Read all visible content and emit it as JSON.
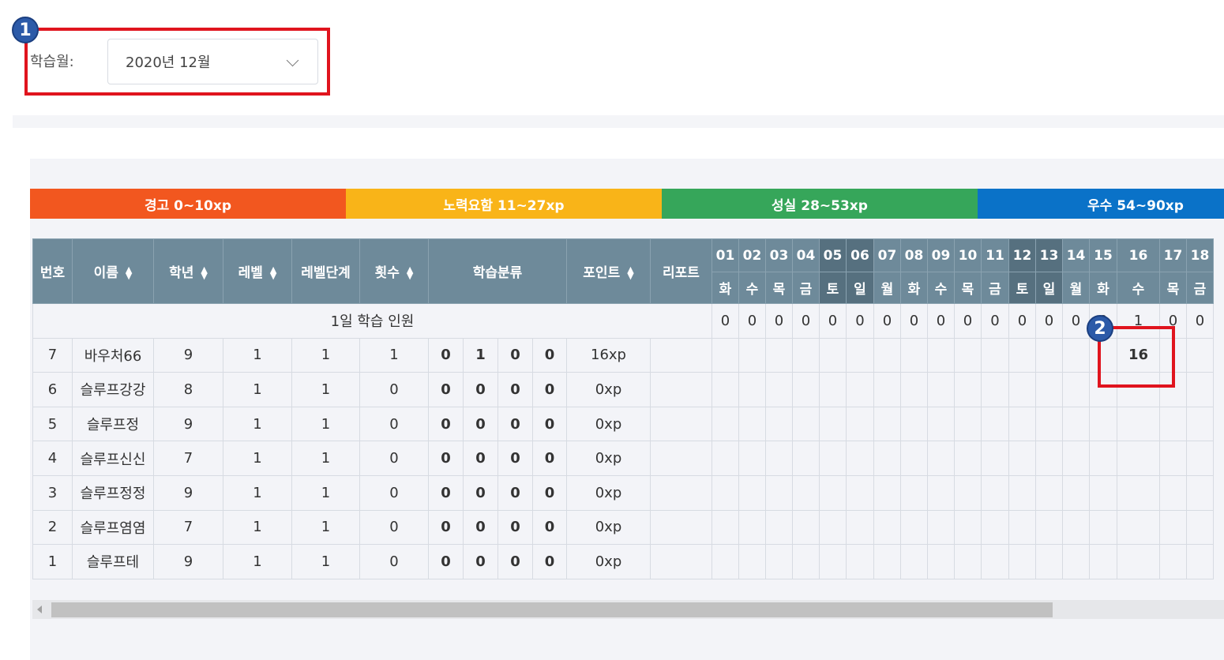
{
  "filter": {
    "label": "학습월:",
    "selected": "2020년 12월"
  },
  "annotations": [
    "1",
    "2"
  ],
  "legend": [
    {
      "label": "경고 0~10xp",
      "color": "#f2571f"
    },
    {
      "label": "노력요함 11~27xp",
      "color": "#f9b418"
    },
    {
      "label": "성실 28~53xp",
      "color": "#36a65a"
    },
    {
      "label": "우수 54~90xp",
      "color": "#0a72c8"
    }
  ],
  "table": {
    "headers": {
      "no": "번호",
      "name": "이름",
      "grade": "학년",
      "level": "레벨",
      "level_step": "레벨단계",
      "count": "횟수",
      "category": "학습분류",
      "points": "포인트",
      "report": "리포트"
    },
    "days": [
      {
        "d": "01",
        "w": "화"
      },
      {
        "d": "02",
        "w": "수"
      },
      {
        "d": "03",
        "w": "목"
      },
      {
        "d": "04",
        "w": "금"
      },
      {
        "d": "05",
        "w": "토"
      },
      {
        "d": "06",
        "w": "일"
      },
      {
        "d": "07",
        "w": "월"
      },
      {
        "d": "08",
        "w": "화"
      },
      {
        "d": "09",
        "w": "수"
      },
      {
        "d": "10",
        "w": "목"
      },
      {
        "d": "11",
        "w": "금"
      },
      {
        "d": "12",
        "w": "토"
      },
      {
        "d": "13",
        "w": "일"
      },
      {
        "d": "14",
        "w": "월"
      },
      {
        "d": "15",
        "w": "화"
      },
      {
        "d": "16",
        "w": "수"
      },
      {
        "d": "17",
        "w": "목"
      },
      {
        "d": "18",
        "w": "금"
      }
    ],
    "daily_label": "1일 학습 인원",
    "daily_counts": [
      "0",
      "0",
      "0",
      "0",
      "0",
      "0",
      "0",
      "0",
      "0",
      "0",
      "0",
      "0",
      "0",
      "0",
      "0",
      "1",
      "0",
      "0"
    ],
    "rows": [
      {
        "no": "7",
        "name": "바우처66",
        "grade": "9",
        "level": "1",
        "level_step": "1",
        "count": "1",
        "cats": [
          "0",
          "1",
          "0",
          "0"
        ],
        "points": "16xp",
        "days": {
          "16": "16"
        }
      },
      {
        "no": "6",
        "name": "슬루프강강",
        "grade": "8",
        "level": "1",
        "level_step": "1",
        "count": "0",
        "cats": [
          "0",
          "0",
          "0",
          "0"
        ],
        "points": "0xp",
        "days": {}
      },
      {
        "no": "5",
        "name": "슬루프정",
        "grade": "9",
        "level": "1",
        "level_step": "1",
        "count": "0",
        "cats": [
          "0",
          "0",
          "0",
          "0"
        ],
        "points": "0xp",
        "days": {}
      },
      {
        "no": "4",
        "name": "슬루프신신",
        "grade": "7",
        "level": "1",
        "level_step": "1",
        "count": "0",
        "cats": [
          "0",
          "0",
          "0",
          "0"
        ],
        "points": "0xp",
        "days": {}
      },
      {
        "no": "3",
        "name": "슬루프정정",
        "grade": "9",
        "level": "1",
        "level_step": "1",
        "count": "0",
        "cats": [
          "0",
          "0",
          "0",
          "0"
        ],
        "points": "0xp",
        "days": {}
      },
      {
        "no": "2",
        "name": "슬루프염염",
        "grade": "7",
        "level": "1",
        "level_step": "1",
        "count": "0",
        "cats": [
          "0",
          "0",
          "0",
          "0"
        ],
        "points": "0xp",
        "days": {}
      },
      {
        "no": "1",
        "name": "슬루프테",
        "grade": "9",
        "level": "1",
        "level_step": "1",
        "count": "0",
        "cats": [
          "0",
          "0",
          "0",
          "0"
        ],
        "points": "0xp",
        "days": {}
      }
    ]
  }
}
